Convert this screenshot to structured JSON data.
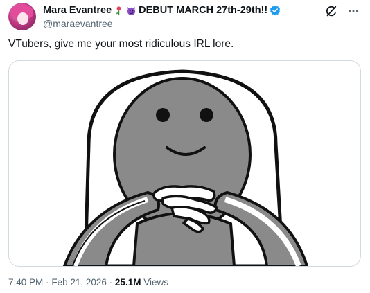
{
  "author": {
    "display_name": "Mara Evantree",
    "title_suffix": "DEBUT MARCH 27th-29th!!",
    "handle": "@maraevantree"
  },
  "icons": [
    "rose-emoji-icon",
    "devil-emoji-icon",
    "verified-badge-icon",
    "grok-icon",
    "more-options-icon"
  ],
  "tweet": {
    "text": "VTubers, give me your most ridiculous IRL lore."
  },
  "meta": {
    "time": "7:40 PM",
    "separator1": "·",
    "date": "Feb 21, 2026",
    "separator2": "·",
    "views_count": "25.1M",
    "views_label": "Views"
  },
  "colors": {
    "text_primary": "#0f1419",
    "text_secondary": "#536471",
    "verified_blue": "#1d9bf0",
    "border": "#cfd9de",
    "figure_gray": "#8a8a8a"
  }
}
